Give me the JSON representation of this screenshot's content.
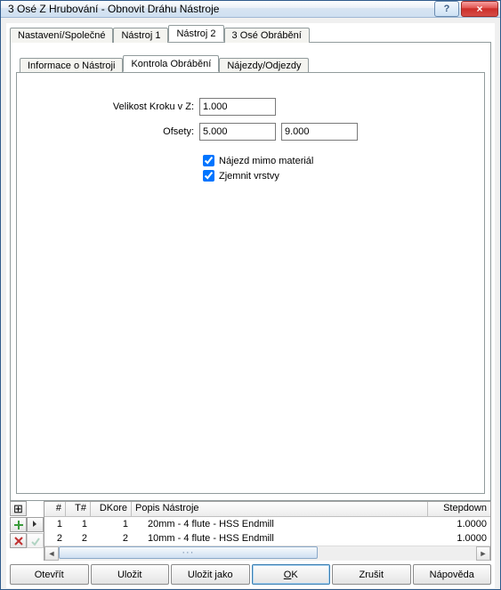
{
  "window": {
    "title": "3 Osé Z Hrubování - Obnovit Dráhu Nástroje"
  },
  "tabs_outer": [
    {
      "label": "Nastavení/Společné",
      "active": false
    },
    {
      "label": "Nástroj 1",
      "active": false
    },
    {
      "label": "Nástroj 2",
      "active": true
    },
    {
      "label": "3 Osé Obrábění",
      "active": false
    }
  ],
  "tabs_inner": [
    {
      "label": "Informace o Nástroji",
      "active": false
    },
    {
      "label": "Kontrola Obrábění",
      "active": true
    },
    {
      "label": "Nájezdy/Odjezdy",
      "active": false
    }
  ],
  "form": {
    "step_label": "Velikost Kroku v Z:",
    "step_value": "1.000",
    "offsets_label": "Ofsety:",
    "offset1": "5.000",
    "offset2": "9.000",
    "chk1_label": "Nájezd mimo materiál",
    "chk1_checked": true,
    "chk2_label": "Zjemnit vrstvy",
    "chk2_checked": true
  },
  "toollist": {
    "headers": {
      "num": "#",
      "tnum": "T#",
      "dkore": "DKore",
      "desc": "Popis Nástroje",
      "stepdown": "Stepdown"
    },
    "rows": [
      {
        "num": "1",
        "tnum": "1",
        "dkore": "1",
        "desc": "20mm  -  4 flute - HSS Endmill",
        "stepdown": "1.0000"
      },
      {
        "num": "2",
        "tnum": "2",
        "dkore": "2",
        "desc": "10mm  -  4 flute - HSS Endmill",
        "stepdown": "1.0000"
      }
    ]
  },
  "buttons": {
    "open": "Otevřít",
    "save": "Uložit",
    "saveas": "Uložit jako",
    "ok": "OK",
    "cancel": "Zrušit",
    "help": "Nápověda"
  }
}
